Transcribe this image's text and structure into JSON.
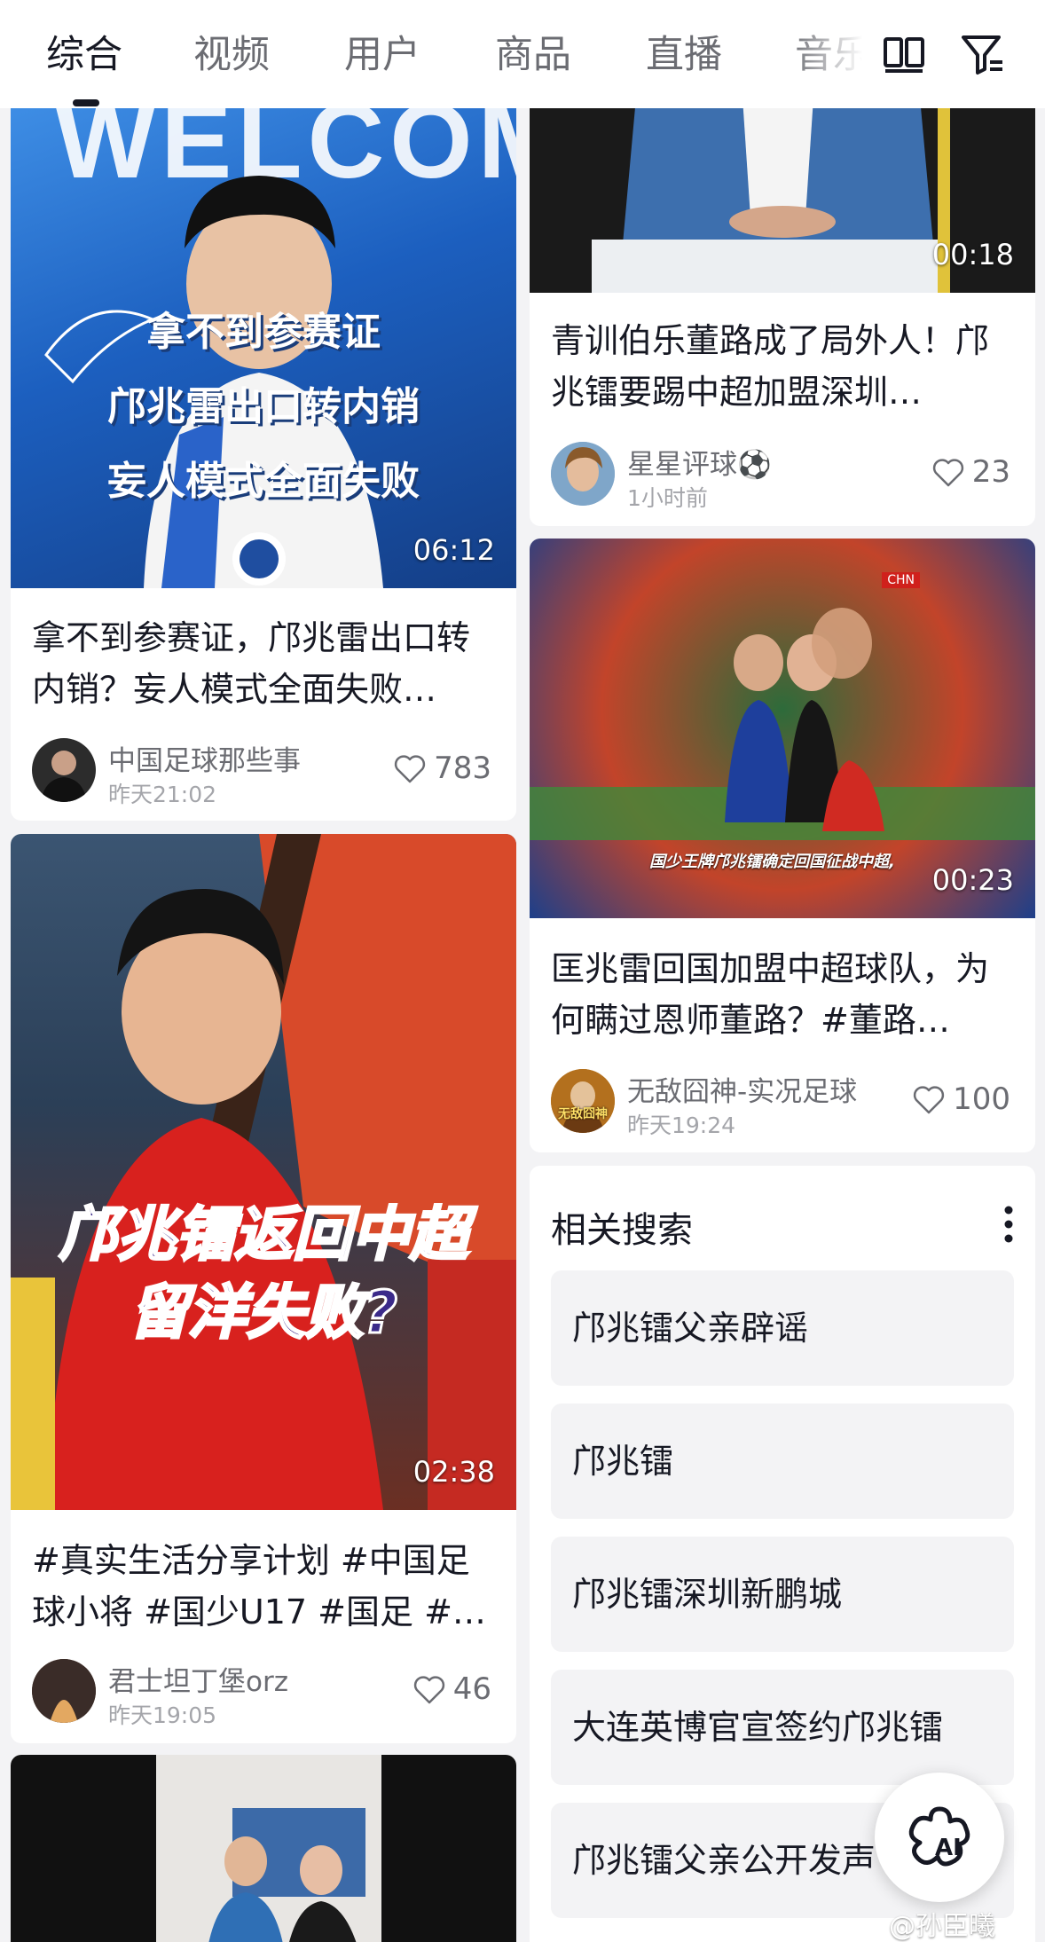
{
  "tabs": [
    {
      "label": "综合",
      "active": true
    },
    {
      "label": "视频"
    },
    {
      "label": "用户"
    },
    {
      "label": "商品"
    },
    {
      "label": "直播"
    },
    {
      "label": "音乐"
    }
  ],
  "icons": {
    "layout": "dual-column-layout-icon",
    "filter": "filter-icon",
    "heart": "heart-outline-icon",
    "more": "more-vertical-icon",
    "ai": "ai-assistant-icon"
  },
  "cards": {
    "left1": {
      "overlay": [
        "拿不到参赛证",
        "邝兆雷出口转内销",
        "妄人模式全面失败"
      ],
      "duration": "06:12",
      "title": "拿不到参赛证，邝兆雷出口转内销？妄人模式全面失败…",
      "author": "中国足球那些事",
      "time": "昨天21:02",
      "likes": "783"
    },
    "left2": {
      "overlay": [
        "邝兆镭返回中超",
        "留洋失败?"
      ],
      "duration": "02:38",
      "title": "#真实生活分享计划 #中国足球小将 #国少U17 #国足 #…",
      "author": "君士坦丁堡orz",
      "time": "昨天19:05",
      "likes": "46"
    },
    "right1": {
      "duration": "00:18",
      "title": "青训伯乐董路成了局外人！邝兆镭要踢中超加盟深圳…",
      "author": "星星评球⚽",
      "time": "1小时前",
      "likes": "23"
    },
    "right2": {
      "badge": "CHN",
      "caption": "国少王牌邝兆镭确定回国征战中超,",
      "duration": "00:23",
      "title": "匡兆雷回国加盟中超球队，为何瞒过恩师董路？#董路…",
      "author": "无敌囧神-实况足球",
      "avatar_text": "无敌囧神",
      "time": "昨天19:24",
      "likes": "100"
    }
  },
  "related": {
    "title": "相关搜索",
    "items": [
      "邝兆镭父亲辟谣",
      "邝兆镭",
      "邝兆镭深圳新鹏城",
      "大连英博官宣签约邝兆镭",
      "邝兆镭父亲公开发声"
    ]
  },
  "ai_label": "AI",
  "watermark": "@孙臣曦",
  "colors": {
    "accent": "#161823",
    "muted": "#6b6c72",
    "background": "#f3f3f5",
    "overlay_purple": "#3b2a8a"
  }
}
